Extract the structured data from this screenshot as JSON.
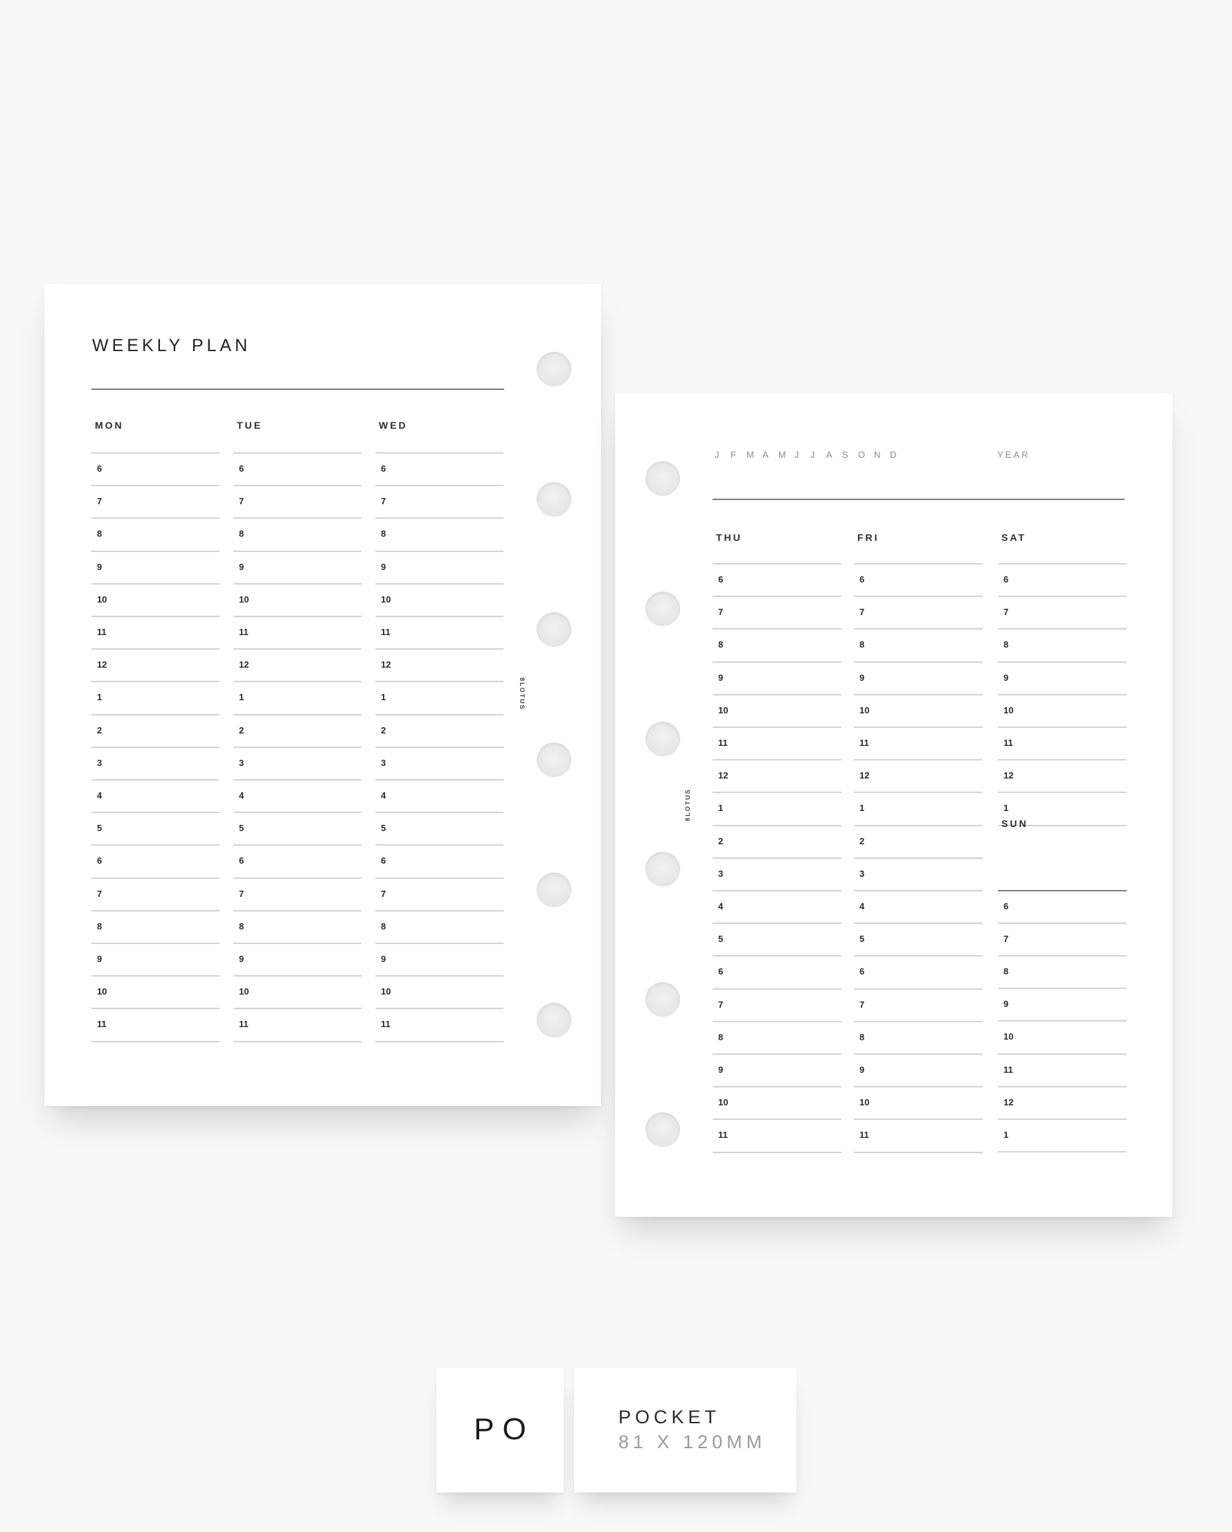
{
  "left_page": {
    "title": "WEEKLY PLAN",
    "brand": "8LOTUS",
    "days": [
      {
        "label": "MON",
        "hours": [
          "6",
          "7",
          "8",
          "9",
          "10",
          "11",
          "12",
          "1",
          "2",
          "3",
          "4",
          "5",
          "6",
          "7",
          "8",
          "9",
          "10",
          "11"
        ]
      },
      {
        "label": "TUE",
        "hours": [
          "6",
          "7",
          "8",
          "9",
          "10",
          "11",
          "12",
          "1",
          "2",
          "3",
          "4",
          "5",
          "6",
          "7",
          "8",
          "9",
          "10",
          "11"
        ]
      },
      {
        "label": "WED",
        "hours": [
          "6",
          "7",
          "8",
          "9",
          "10",
          "11",
          "12",
          "1",
          "2",
          "3",
          "4",
          "5",
          "6",
          "7",
          "8",
          "9",
          "10",
          "11"
        ]
      }
    ]
  },
  "right_page": {
    "months": [
      "J",
      "F",
      "M",
      "A",
      "M",
      "J",
      "J",
      "A",
      "S",
      "O",
      "N",
      "D"
    ],
    "year_label": "YEAR",
    "brand": "8LOTUS",
    "days": [
      {
        "label": "THU",
        "hours": [
          "6",
          "7",
          "8",
          "9",
          "10",
          "11",
          "12",
          "1",
          "2",
          "3",
          "4",
          "5",
          "6",
          "7",
          "8",
          "9",
          "10",
          "11"
        ]
      },
      {
        "label": "FRI",
        "hours": [
          "6",
          "7",
          "8",
          "9",
          "10",
          "11",
          "12",
          "1",
          "2",
          "3",
          "4",
          "5",
          "6",
          "7",
          "8",
          "9",
          "10",
          "11"
        ]
      },
      {
        "label": "SAT",
        "hours": [
          "6",
          "7",
          "8",
          "9",
          "10",
          "11",
          "12",
          "1"
        ]
      },
      {
        "label": "SUN",
        "hours": [
          "6",
          "7",
          "8",
          "9",
          "10",
          "11",
          "12",
          "1"
        ]
      }
    ]
  },
  "size_badge": {
    "code": "PO",
    "name": "POCKET",
    "dimensions": "81 X 120MM"
  }
}
